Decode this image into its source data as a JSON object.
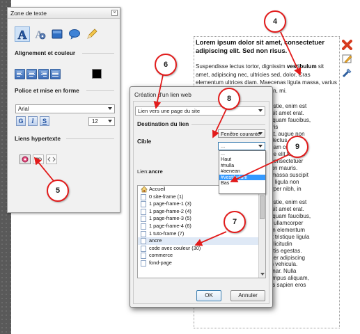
{
  "page_text": {
    "heading": "Lorem ipsum dolor sit amet, consectetuer adipiscing elit. Sed non risus.",
    "para_before": "Suspendisse lectus tortor, dignissim ",
    "para_bold": "vestibulum",
    "para_after": " sit amet, adipiscing nec, ultricies sed, dolor. Cras elementum ultrices diam. Maecenas ligula massa, varius a, semper congue, euismod non, mi.",
    "fragments": [
      "my molestie, enim est",
      "am nisl sit amet erat.",
      "ellus, aliquam faucibus,",
      "us. Mauris",
      "in feugiat, augue non",
      "agna et lectus, et",
      "us. Aliquam convallis",
      "us. Fusce elit lobortis",
      "t amet, consectetuer",
      "n erat non mauris.",
      "orci vel massa suscipit",
      "e varius, ligula non",
      "ullamcorper nibh, in",
      "a.",
      "my molestie, enim est",
      "am nisl sit amet erat.",
      "ellus, aliquam faucibus,",
      ". Mauris ullamcorper",
      "ugue non elementum",
      "ectus, et tristique ligula",
      "vallis sollicitudin",
      "elit lobortis egestas.",
      "nsectetuer adipiscing",
      "convallis vehicula.",
      "ipit pulvinar. Nulla",
      "a non tempus aliquam,",
      "n tempus sapien eros"
    ]
  },
  "panel": {
    "title": "Zone de texte",
    "close_glyph": "×",
    "tools": [
      "text-style-icon",
      "text-effect-icon",
      "background-icon",
      "bubble-icon",
      "pencil-icon"
    ],
    "section_align": "Alignement et couleur",
    "text_color": "#000000",
    "section_font": "Police et mise en forme",
    "font_value": "Arial",
    "bold_label": "G",
    "italic_label": "I",
    "underline_label": "S",
    "size_value": "12",
    "section_links": "Liens hypertexte",
    "link_buttons": [
      "link-active-icon",
      "link-icon",
      "code-icon"
    ]
  },
  "dialog": {
    "title": "Création d'un lien web",
    "link_type": "Lien vers une page du site",
    "destination_title": "Destination du lien",
    "target_label": "Cible",
    "window_value": "Fenêtre courante",
    "anchor_value": "...",
    "anchor_options": [
      "...",
      "Haut",
      "#nulla",
      "#aenean",
      "#vestibulum",
      "Bas"
    ],
    "anchor_selected": "#vestibulum",
    "link_label": "Lien:",
    "link_value": "ancre",
    "pages": [
      {
        "label": "Accueil",
        "icon": "home-icon"
      },
      {
        "label": "0 site-frame (1)",
        "icon": "page-icon"
      },
      {
        "label": "1 page-frame-1 (3)",
        "icon": "page-icon"
      },
      {
        "label": "1 page-frame-2 (4)",
        "icon": "page-icon"
      },
      {
        "label": "1 page-frame-3 (5)",
        "icon": "page-icon"
      },
      {
        "label": "1 page-frame-4 (6)",
        "icon": "page-icon"
      },
      {
        "label": "1 tuto-frame (7)",
        "icon": "page-icon"
      },
      {
        "label": "ancre",
        "icon": "page-icon"
      },
      {
        "label": "code avec couleur (30)",
        "icon": "page-icon"
      },
      {
        "label": "commerce",
        "icon": "page-icon"
      },
      {
        "label": "fond-page",
        "icon": "page-icon"
      }
    ],
    "selected_page": "ancre",
    "ok_label": "OK",
    "cancel_label": "Annuler"
  },
  "callouts": [
    "4",
    "5",
    "6",
    "7",
    "8",
    "9"
  ],
  "colors": {
    "callout_border": "#e21b1b",
    "selection": "#3399ff",
    "accent": "#3c7fb1"
  }
}
